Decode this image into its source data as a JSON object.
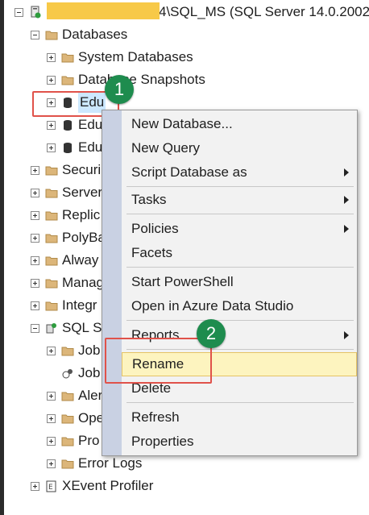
{
  "server": {
    "label_suffix": "4\\SQL_MS (SQL Server 14.0.2002."
  },
  "tree": {
    "databases": "Databases",
    "system_databases": "System Databases",
    "snapshots": "Database Snapshots",
    "edu1": "Edu",
    "edu2": "Edu",
    "edu3": "Edu",
    "security": "Securi",
    "server_objects": "Server",
    "replication": "Replic",
    "polybase": "PolyBa",
    "always_on": "Alway",
    "management": "Manag",
    "integration": "Integr",
    "sql_agent": "SQL S",
    "jobs": "Job",
    "job_activity": "Job",
    "alerts": "Aler",
    "operators": "Ope",
    "proxies": "Pro",
    "error_logs": "Error Logs",
    "xevent": "XEvent Profiler"
  },
  "context_menu": {
    "new_database": "New Database...",
    "new_query": "New Query",
    "script_database_as": "Script Database as",
    "tasks": "Tasks",
    "policies": "Policies",
    "facets": "Facets",
    "start_powershell": "Start PowerShell",
    "open_azure": "Open in Azure Data Studio",
    "reports": "Reports",
    "rename": "Rename",
    "delete": "Delete",
    "refresh": "Refresh",
    "properties": "Properties"
  },
  "badges": {
    "step1": "1",
    "step2": "2"
  },
  "colors": {
    "badge": "#1e8c4e",
    "highlight_box": "#e0524a",
    "menu_hover": "#fdf4bf",
    "selection": "#cce8ff"
  }
}
